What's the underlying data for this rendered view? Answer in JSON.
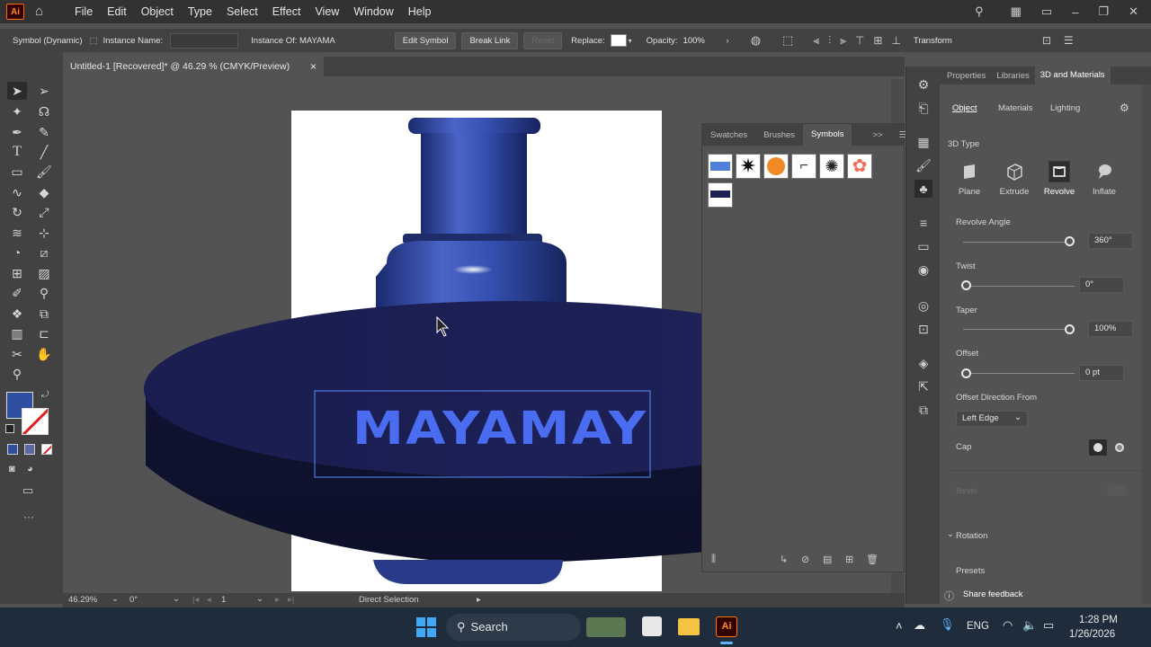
{
  "app": {
    "logo": "Ai"
  },
  "menu": [
    "File",
    "Edit",
    "Object",
    "Type",
    "Select",
    "Effect",
    "View",
    "Window",
    "Help"
  ],
  "control_bar": {
    "object_type": "Symbol (Dynamic)",
    "instance_name_label": "Instance Name:",
    "instance_of_label": "Instance Of: MAYAMA",
    "edit_symbol": "Edit Symbol",
    "break_link": "Break Link",
    "reset": "Reset",
    "replace_label": "Replace:",
    "opacity_label": "Opacity:",
    "opacity_value": "100%",
    "transform": "Transform"
  },
  "document_tab": {
    "title": "Untitled-1 [Recovered]* @ 46.29 % (CMYK/Preview)",
    "close": "×"
  },
  "canvas": {
    "mayamay_text": "MAYAMAY"
  },
  "status_bar": {
    "zoom": "46.29%",
    "rotation": "0°",
    "artboard": "1",
    "tool": "Direct Selection"
  },
  "symbols_panel": {
    "tabs": [
      "Swatches",
      "Brushes",
      "Symbols"
    ],
    "active_tab": "Symbols",
    "expand": ">>"
  },
  "properties_panel": {
    "tabs": [
      "Properties",
      "Libraries",
      "3D and Materials"
    ],
    "active_tab": "3D and Materials",
    "subtabs": [
      "Object",
      "Materials",
      "Lighting"
    ],
    "active_subtab": "Object",
    "type_heading": "3D Type",
    "types": [
      "Plane",
      "Extrude",
      "Revolve",
      "Inflate"
    ],
    "active_type": "Revolve",
    "revolve_angle": {
      "label": "Revolve Angle",
      "value": "360°",
      "fraction": 1.0
    },
    "twist": {
      "label": "Twist",
      "value": "0°",
      "fraction": 0.0
    },
    "taper": {
      "label": "Taper",
      "value": "100%",
      "fraction": 1.0
    },
    "offset": {
      "label": "Offset",
      "value": "0 pt",
      "fraction": 0.0
    },
    "offset_direction_label": "Offset Direction From",
    "offset_direction_value": "Left Edge",
    "cap_label": "Cap",
    "bevel_label": "Bevel",
    "rotation_label": "Rotation",
    "presets_label": "Presets",
    "share_feedback": "Share feedback"
  },
  "taskbar": {
    "search": "Search",
    "language": "ENG",
    "time": "1:28 PM",
    "date": "1/26/2026"
  },
  "colors": {
    "accent": "#2f4fa0",
    "artwork_navy": "#1c1f52",
    "text_blue": "#4a6cf0"
  }
}
